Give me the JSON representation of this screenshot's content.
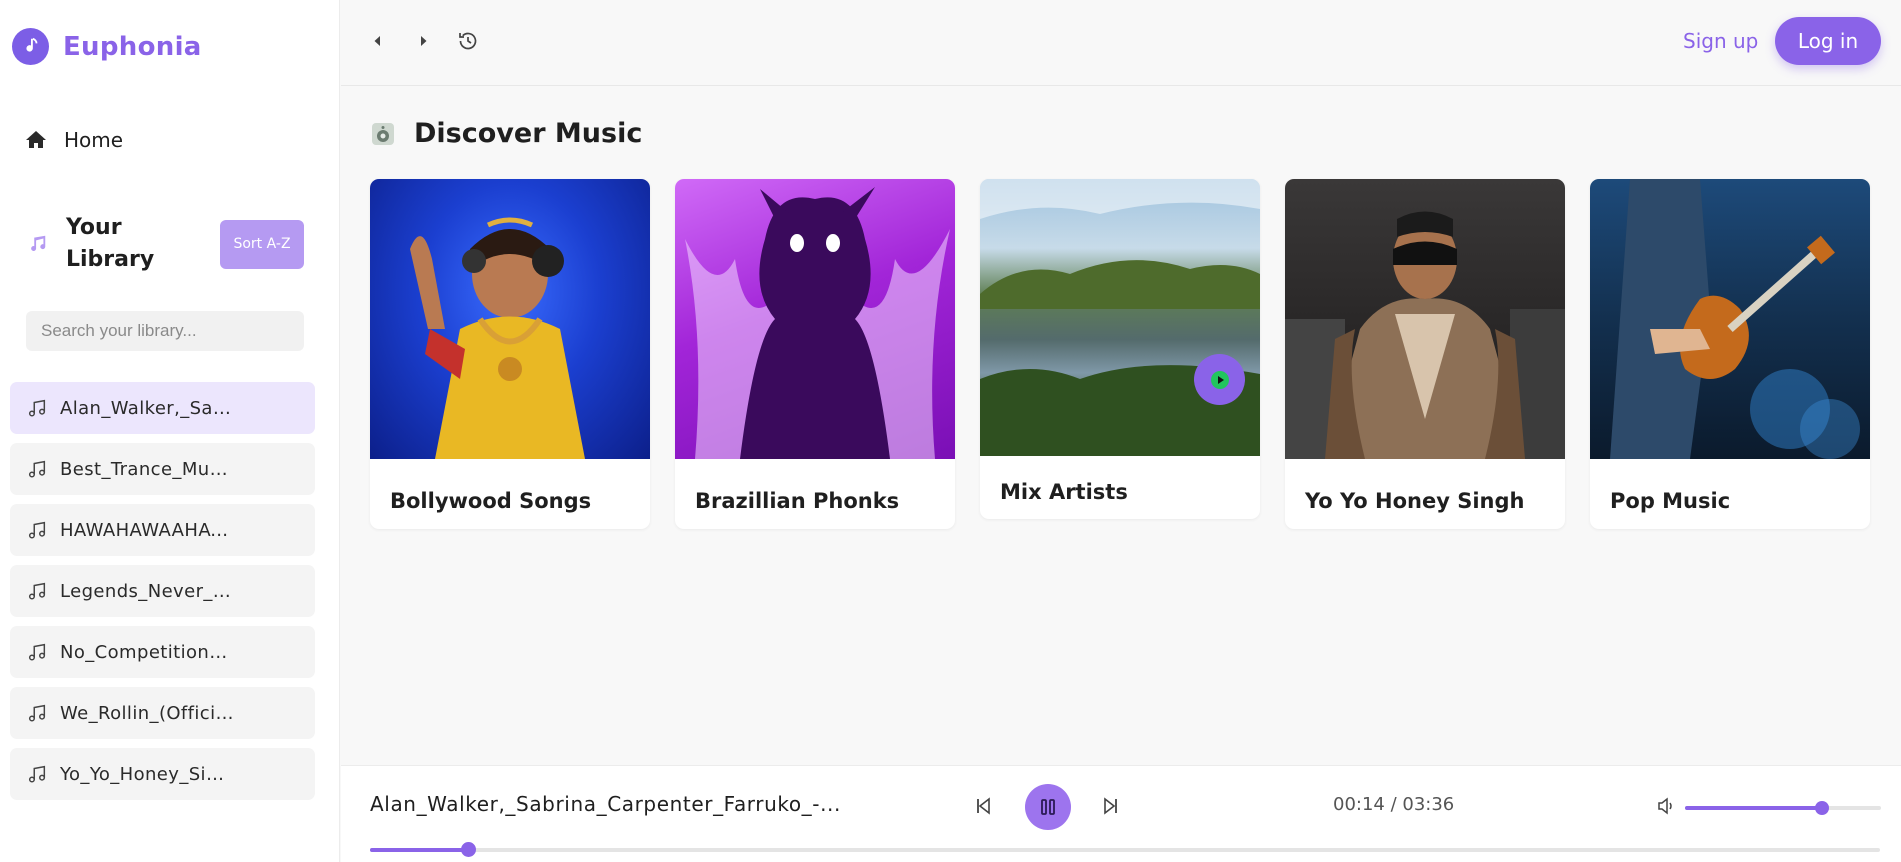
{
  "app": {
    "name": "Euphonia"
  },
  "sidebar": {
    "home_label": "Home",
    "library_title": "Your Library",
    "sort_label": "Sort A-Z",
    "search_placeholder": "Search your library...",
    "items": [
      {
        "label": "Alan_Walker,_Sab...",
        "active": true
      },
      {
        "label": "Best_Trance_Musi...",
        "active": false
      },
      {
        "label": "HAWAHAWAAHAW...",
        "active": false
      },
      {
        "label": "Legends_Never_D...",
        "active": false
      },
      {
        "label": "No_Competition_...",
        "active": false
      },
      {
        "label": "We_Rollin_(Officia...",
        "active": false
      },
      {
        "label": "Yo_Yo_Honey_Sin...",
        "active": false
      }
    ]
  },
  "topbar": {
    "back_icon": "chevron-left-icon",
    "forward_icon": "chevron-right-icon",
    "history_icon": "history-icon",
    "signup_label": "Sign up",
    "login_label": "Log in"
  },
  "discover": {
    "title": "Discover Music",
    "cards": [
      {
        "title": "Bollywood Songs",
        "art": "bollywood-art"
      },
      {
        "title": "Brazillian Phonks",
        "art": "phonk-art"
      },
      {
        "title": "Mix Artists",
        "art": "lake-art",
        "hovered": true
      },
      {
        "title": "Yo Yo Honey Singh",
        "art": "honey-singh-art"
      },
      {
        "title": "Pop Music",
        "art": "guitarist-art"
      }
    ]
  },
  "player": {
    "now_playing": "Alan_Walker,_Sabrina_Carpenter_Farruko_-...",
    "current_time": "00:14",
    "separator": " / ",
    "duration": "03:36",
    "progress": 0.065,
    "volume": 0.7
  },
  "colors": {
    "accent": "#8a63e8",
    "accent_light": "#b59af2",
    "active_item": "#ece6fd"
  }
}
